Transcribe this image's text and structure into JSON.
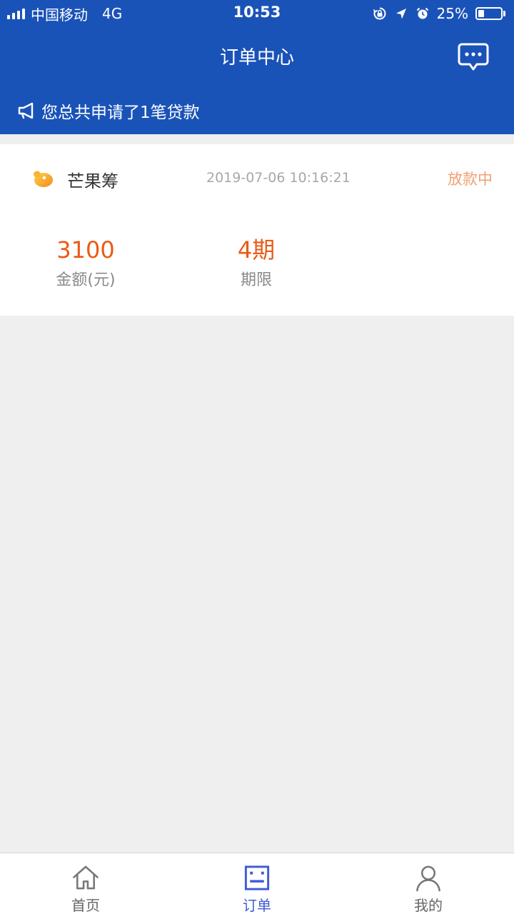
{
  "status_bar": {
    "carrier": "中国移动",
    "network": "4G",
    "time": "10:53",
    "battery_percent": "25%",
    "battery_level": 0.25
  },
  "nav": {
    "title": "订单中心",
    "message_icon": "chat-bubble-icon"
  },
  "notice": {
    "icon": "megaphone-icon",
    "text": "您总共申请了1笔贷款"
  },
  "order": {
    "brand_icon": "mango-logo-icon",
    "brand_name": "芒果筹",
    "date": "2019-07-06 10:16:21",
    "status": "放款中",
    "amount_value": "3100",
    "amount_label": "金额(元)",
    "term_value": "4期",
    "term_label": "期限"
  },
  "tabbar": {
    "items": [
      {
        "label": "首页",
        "icon": "home-icon",
        "active": false
      },
      {
        "label": "订单",
        "icon": "order-list-icon",
        "active": true
      },
      {
        "label": "我的",
        "icon": "user-icon",
        "active": false
      }
    ]
  },
  "colors": {
    "header_bg": "#1a53b8",
    "accent_orange": "#ea5a14",
    "status_orange": "#f0a070",
    "tab_active": "#3f5bd6",
    "page_bg": "#efefef"
  }
}
